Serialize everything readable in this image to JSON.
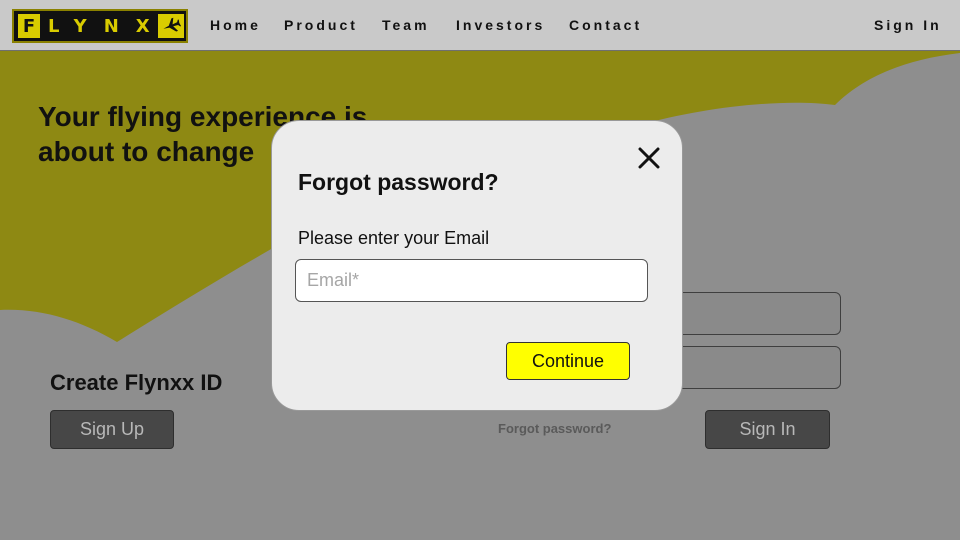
{
  "colors": {
    "accent_yellow": "#ffff00",
    "hero_olive": "#8e8913",
    "overlay_gray": "#8e8e8e",
    "modal_bg": "#ececec"
  },
  "navbar": {
    "logo": {
      "letters": "FLYNX",
      "box_letter": "F",
      "icon": "airplane-icon"
    },
    "links": [
      "Home",
      "Product",
      "Team",
      "Investors",
      "Contact"
    ],
    "sign_in": "Sign In"
  },
  "hero": {
    "title_line1": "Your flying experience is",
    "title_line2": "about to change"
  },
  "signup": {
    "title": "Create Flynxx ID",
    "button": "Sign Up"
  },
  "login": {
    "forgot_link": "Forgot password?",
    "button": "Sign In"
  },
  "modal": {
    "title": "Forgot password?",
    "label": "Please enter your Email",
    "email_placeholder": "Email*",
    "email_value": "",
    "continue": "Continue",
    "close_icon": "close-icon"
  }
}
